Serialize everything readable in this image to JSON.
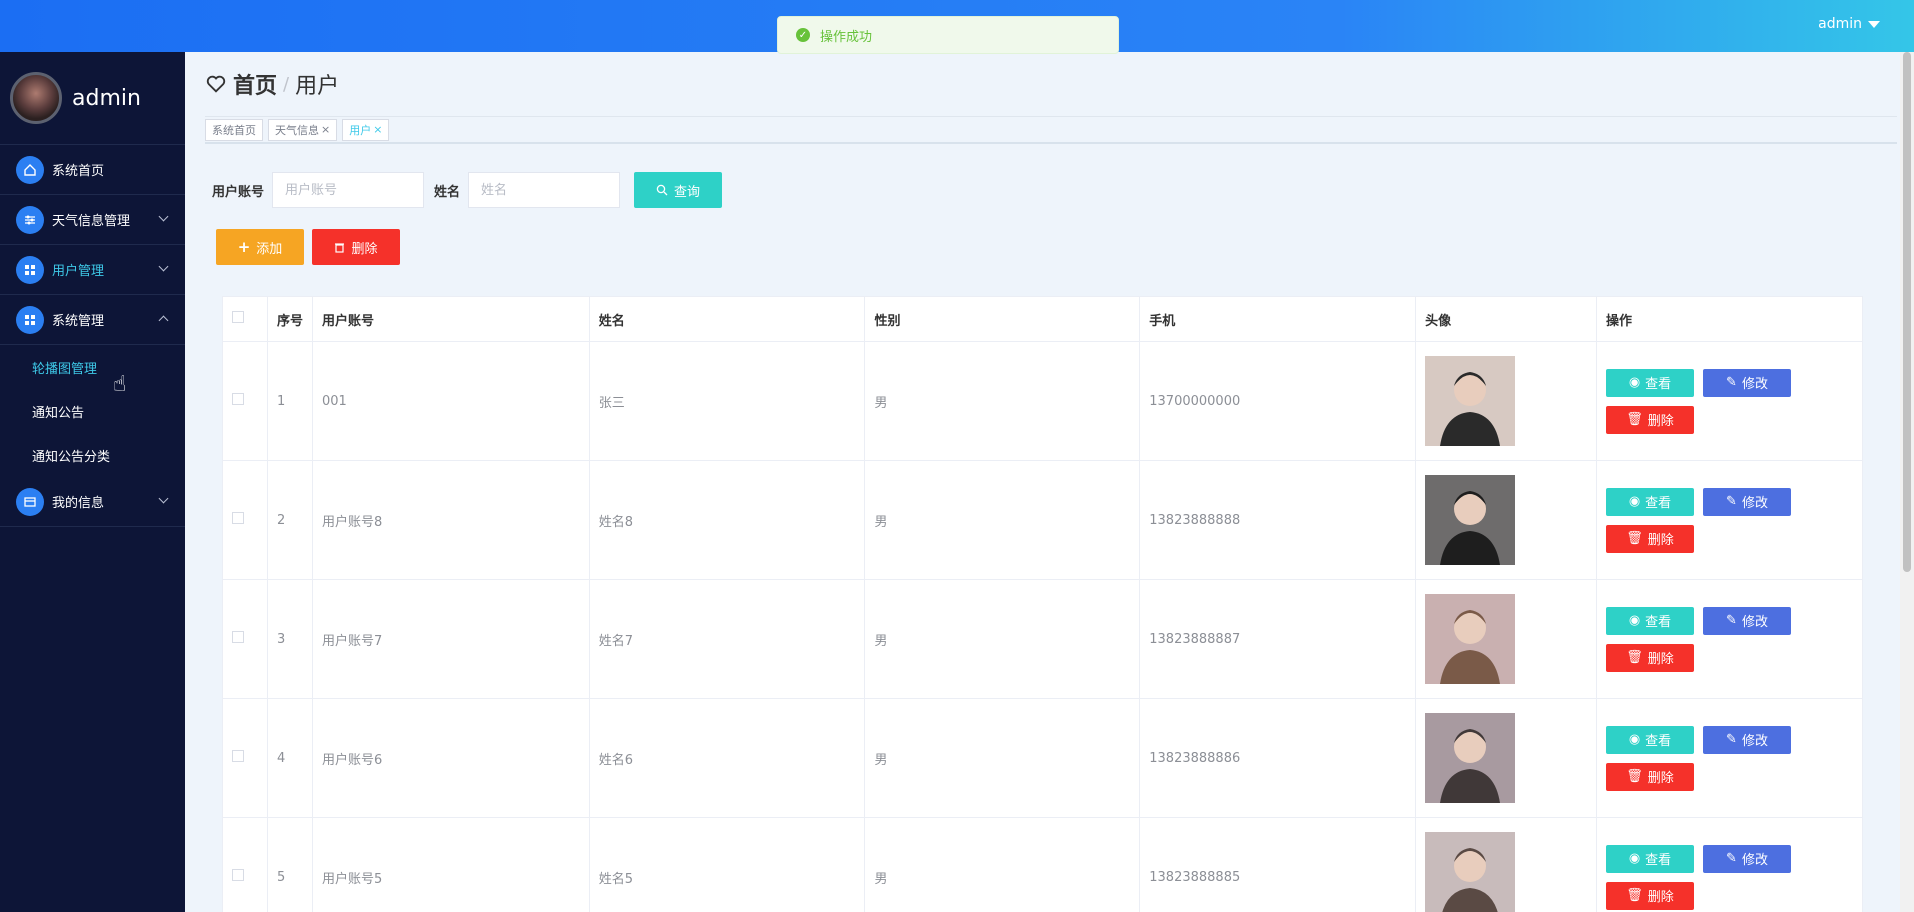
{
  "header": {
    "username": "admin"
  },
  "toast": {
    "message": "操作成功"
  },
  "sidebar": {
    "brand": "admin",
    "items": [
      {
        "label": "系统首页",
        "icon": "home-icon"
      },
      {
        "label": "天气信息管理",
        "icon": "sliders-icon"
      },
      {
        "label": "用户管理",
        "icon": "grid-icon"
      },
      {
        "label": "系统管理",
        "icon": "grid-icon"
      },
      {
        "label": "我的信息",
        "icon": "card-icon"
      }
    ],
    "submenu": [
      "轮播图管理",
      "通知公告",
      "通知公告分类"
    ]
  },
  "breadcrumb": {
    "home": "首页",
    "current": "用户"
  },
  "tabs": [
    {
      "label": "系统首页"
    },
    {
      "label": "天气信息"
    },
    {
      "label": "用户"
    }
  ],
  "search": {
    "account_label": "用户账号",
    "account_placeholder": "用户账号",
    "name_label": "姓名",
    "name_placeholder": "姓名",
    "query_label": "查询"
  },
  "actions": {
    "add": "添加",
    "delete": "删除"
  },
  "table": {
    "headers": [
      "序号",
      "用户账号",
      "姓名",
      "性别",
      "手机",
      "头像",
      "操作"
    ],
    "rows": [
      {
        "idx": "1",
        "account": "001",
        "name": "张三",
        "gender": "男",
        "phone": "13700000000"
      },
      {
        "idx": "2",
        "account": "用户账号8",
        "name": "姓名8",
        "gender": "男",
        "phone": "13823888888"
      },
      {
        "idx": "3",
        "account": "用户账号7",
        "name": "姓名7",
        "gender": "男",
        "phone": "13823888887"
      },
      {
        "idx": "4",
        "account": "用户账号6",
        "name": "姓名6",
        "gender": "男",
        "phone": "13823888886"
      },
      {
        "idx": "5",
        "account": "用户账号5",
        "name": "姓名5",
        "gender": "男",
        "phone": "13823888885"
      }
    ],
    "ops": {
      "view": "查看",
      "edit": "修改",
      "remove": "删除"
    }
  },
  "colors": {
    "accent": "#2ed1c7",
    "danger": "#f5312a",
    "warning": "#f6a523",
    "edit": "#4d6fe0",
    "sidebar": "#0d1537"
  }
}
